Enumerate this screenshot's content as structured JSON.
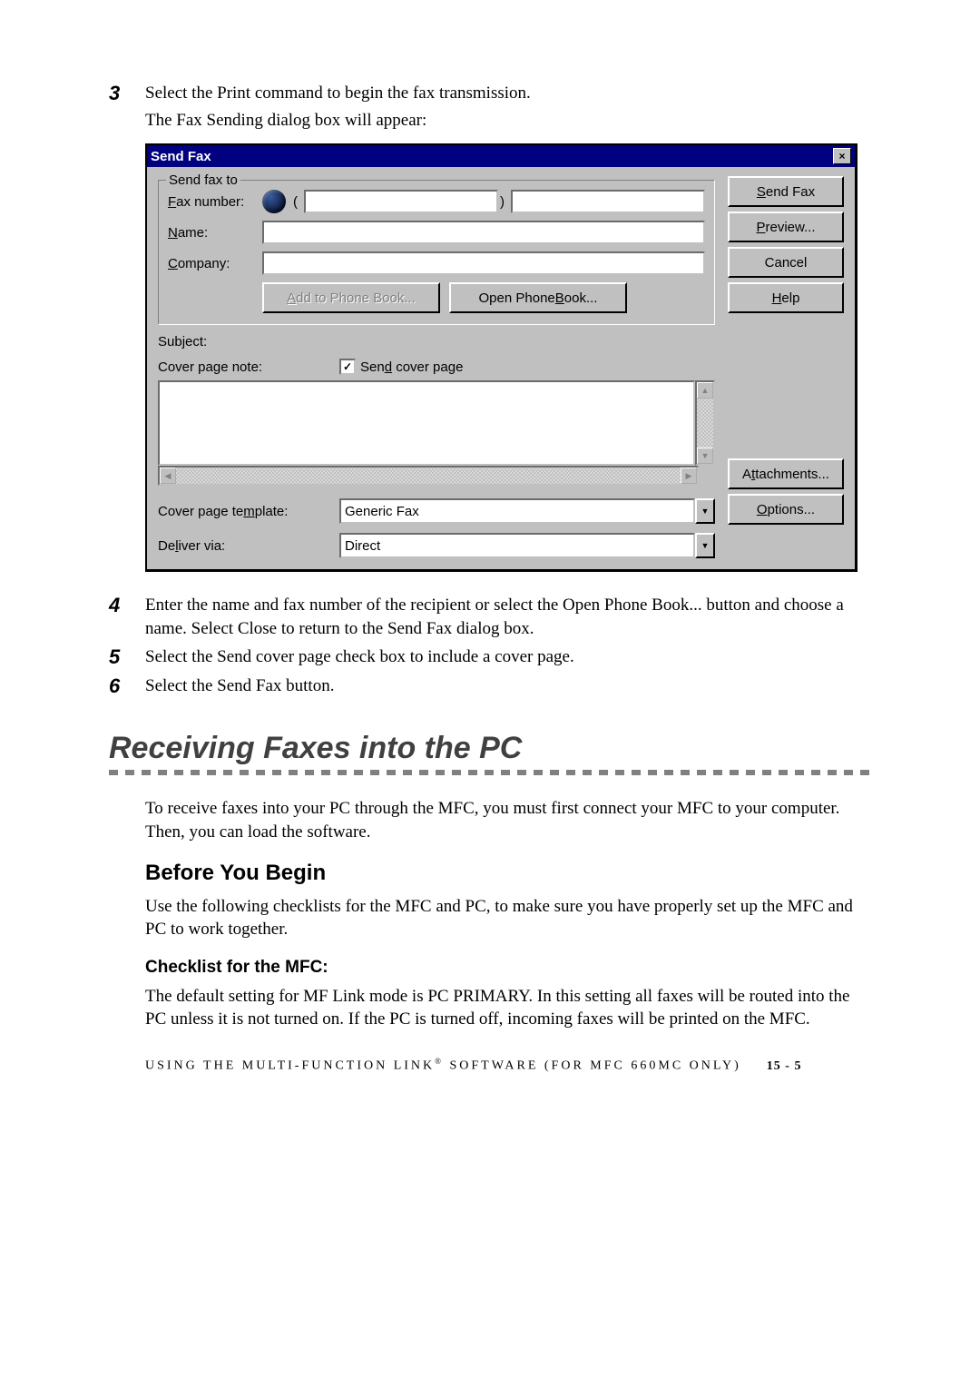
{
  "steps": {
    "s3": {
      "num": "3",
      "text": "Select the Print command to begin the fax transmission.",
      "sub": "The Fax Sending dialog box will appear:"
    },
    "s4": {
      "num": "4",
      "text": "Enter the name and fax number of the recipient or select the Open Phone Book... button and choose a name.  Select Close to return to the Send Fax dialog box."
    },
    "s5": {
      "num": "5",
      "text": "Select the Send cover page check box to include a cover page."
    },
    "s6": {
      "num": "6",
      "text": "Select the Send Fax button."
    }
  },
  "dialog": {
    "title": "Send Fax",
    "close": "×",
    "group_legend": "Send fax to",
    "fax_label_pre": "F",
    "fax_label_post": "ax number:",
    "name_label_pre": "N",
    "name_label_post": "ame:",
    "comp_label_pre": "C",
    "comp_label_post": "ompany:",
    "paren_open": "(",
    "paren_close": ")",
    "add_phone_pre": "A",
    "add_phone_post": "dd to Phone Book...",
    "open_phone_pre": "Open Phone ",
    "open_phone_u": "B",
    "open_phone_post": "ook...",
    "subject_label": "Subject:",
    "cover_note_label": "Cover page note:",
    "send_cover_pre": "Sen",
    "send_cover_u": "d",
    "send_cover_post": " cover page",
    "check_mark": "✓",
    "cover_tmpl_label_pre": "Cover page te",
    "cover_tmpl_u": "m",
    "cover_tmpl_label_post": "plate:",
    "cover_tmpl_value": "Generic Fax",
    "deliver_label_pre": "De",
    "deliver_u": "l",
    "deliver_label_post": "iver via:",
    "deliver_value": "Direct",
    "btn_send_pre": "S",
    "btn_send_post": "end Fax",
    "btn_preview_pre": "P",
    "btn_preview_post": "review...",
    "btn_cancel": "Cancel",
    "btn_help_pre": "H",
    "btn_help_post": "elp",
    "btn_attach_pre": "A",
    "btn_attach_u": "t",
    "btn_attach_post": "tachments...",
    "btn_options_pre": "O",
    "btn_options_post": "ptions...",
    "arrow_up": "▲",
    "arrow_down": "▼",
    "arrow_left": "◀",
    "arrow_right": "▶"
  },
  "section": {
    "title": "Receiving Faxes into the PC",
    "intro": "To receive faxes into your PC through the MFC, you must first connect your MFC to your computer. Then, you can load the software.",
    "h2": "Before You Begin",
    "h2_body": "Use the following checklists for the MFC and PC, to make sure you have properly set up the MFC and PC to work together.",
    "h3": "Checklist for the MFC:",
    "h3_body": "The default setting for MF Link mode is PC PRIMARY. In this setting all faxes will be routed into the PC unless it is not turned on. If the PC is turned off, incoming faxes will be printed on the MFC."
  },
  "footer": {
    "text_a": "USING THE MULTI-FUNCTION LINK",
    "reg": "®",
    "text_b": " SOFTWARE (FOR MFC 660MC ONLY)",
    "page": "15 - 5"
  }
}
